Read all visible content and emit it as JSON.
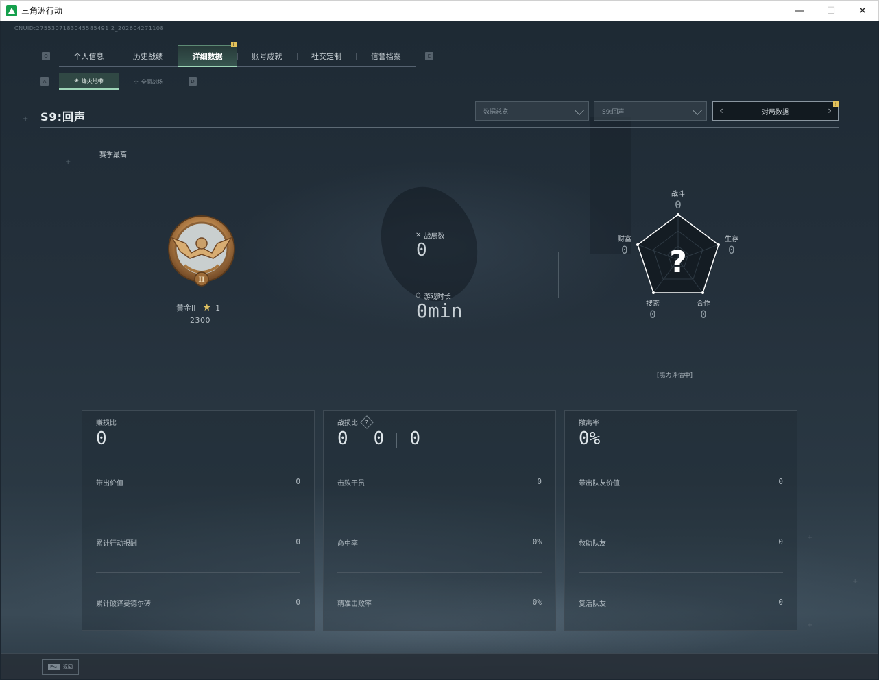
{
  "window": {
    "title": "三角洲行动",
    "controls": [
      "minimize",
      "maximize",
      "close"
    ]
  },
  "uid_text": "CNUID:2755307183045585491 2_202604271108",
  "tabs": {
    "left_key": "Q",
    "right_key": "E",
    "items": [
      {
        "label": "个人信息",
        "active": false
      },
      {
        "label": "历史战绩",
        "active": false
      },
      {
        "label": "详细数据",
        "active": true,
        "badge": "!"
      },
      {
        "label": "账号成就",
        "active": false
      },
      {
        "label": "社交定制",
        "active": false
      },
      {
        "label": "信誉档案",
        "active": false
      }
    ]
  },
  "subtabs": {
    "left_key": "A",
    "right_key": "D",
    "items": [
      {
        "label": "烽火地带",
        "active": true,
        "icon": "zone-icon"
      },
      {
        "label": "全面战场",
        "active": false,
        "icon": "battlefield-icon"
      }
    ]
  },
  "season": {
    "title": "S9:回声",
    "filters": {
      "data_type": "数据总览",
      "season_select": "S9:回声",
      "pager_label": "对局数据",
      "pager_badge": "!"
    },
    "best_label": "赛季最高"
  },
  "rank": {
    "name": "黄金II",
    "stars": "1",
    "score": "2300",
    "medal_numeral": "II"
  },
  "summary": {
    "matches_label": "战局数",
    "matches_value": "0",
    "playtime_label": "游戏时长",
    "playtime_value": "0min"
  },
  "radar": {
    "combat": {
      "label": "战斗",
      "value": "0"
    },
    "survival": {
      "label": "生存",
      "value": "0"
    },
    "teamwork": {
      "label": "合作",
      "value": "0"
    },
    "search": {
      "label": "搜索",
      "value": "0"
    },
    "wealth": {
      "label": "财富",
      "value": "0"
    },
    "center": "?",
    "assessing": "[能力评估中]"
  },
  "cards": [
    {
      "title": "赚损比",
      "big": [
        "0"
      ],
      "rows": [
        {
          "label": "带出价值",
          "value": "0"
        },
        {
          "label": "累计行动报酬",
          "value": "0"
        },
        {
          "label": "累计破译曼德尔砖",
          "value": "0"
        }
      ]
    },
    {
      "title": "战损比",
      "has_help": true,
      "help": "?",
      "big": [
        "0",
        "0",
        "0"
      ],
      "rows": [
        {
          "label": "击败干员",
          "value": "0"
        },
        {
          "label": "命中率",
          "value": "0%"
        },
        {
          "label": "精准击败率",
          "value": "0%"
        }
      ]
    },
    {
      "title": "撤离率",
      "big": [
        "0%"
      ],
      "rows": [
        {
          "label": "带出队友价值",
          "value": "0"
        },
        {
          "label": "救助队友",
          "value": "0"
        },
        {
          "label": "复活队友",
          "value": "0"
        }
      ]
    }
  ],
  "footer": {
    "esc_key": "Esc",
    "back_label": "返回"
  },
  "colors": {
    "accent": "#9fd6b8",
    "badge": "#e3c25b",
    "background": "#1c2630"
  }
}
